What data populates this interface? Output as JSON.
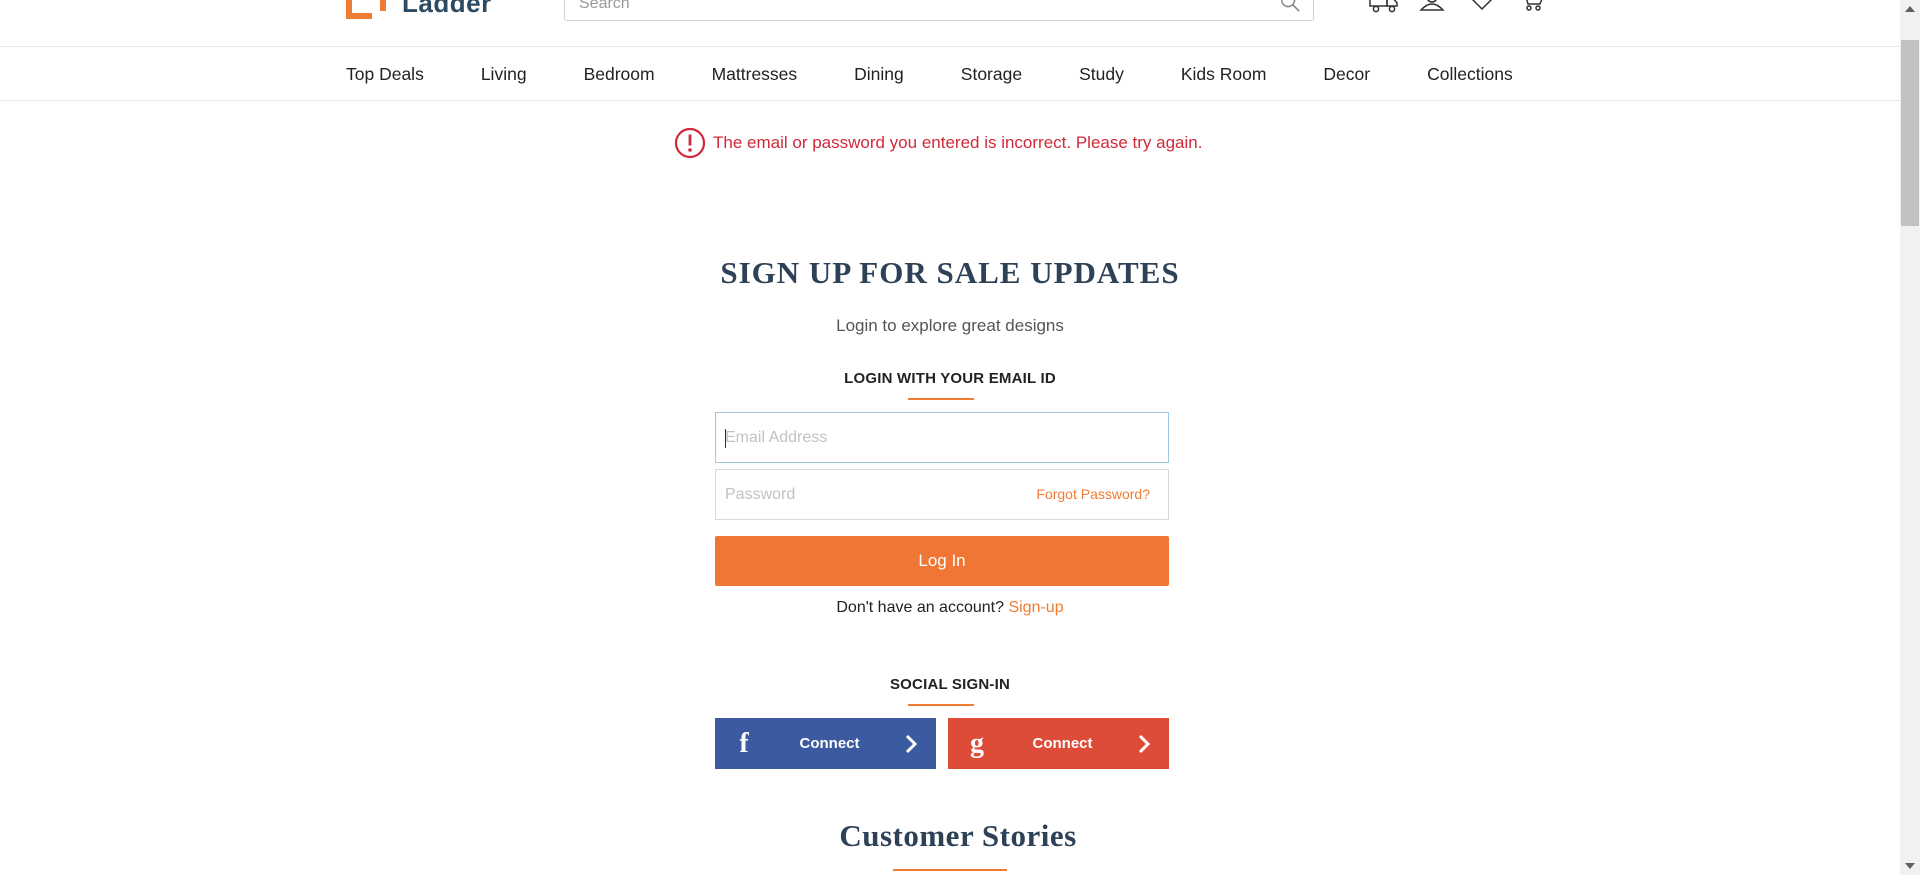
{
  "brand": {
    "name": "Ladder",
    "accent": "#f07c33",
    "text_color": "#2d4a63"
  },
  "search": {
    "placeholder": "Search"
  },
  "header_icons": [
    "delivery-truck-icon",
    "user-profile-icon",
    "wishlist-heart-icon",
    "cart-icon"
  ],
  "nav": {
    "items": [
      "Top Deals",
      "Living",
      "Bedroom",
      "Mattresses",
      "Dining",
      "Storage",
      "Study",
      "Kids Room",
      "Decor",
      "Collections"
    ]
  },
  "alert": {
    "message": "The email or password you entered is incorrect. Please try again.",
    "color": "#d0293a"
  },
  "login": {
    "title": "SIGN UP FOR SALE UPDATES",
    "subtitle": "Login to explore great designs",
    "section_heading": "LOGIN WITH YOUR EMAIL ID",
    "email_placeholder": "Email Address",
    "password_placeholder": "Password",
    "forgot_label": "Forgot Password?",
    "login_button": "Log In",
    "no_account_text": "Don't have an account?",
    "signup_link": "Sign-up"
  },
  "social": {
    "heading": "SOCIAL SIGN-IN",
    "facebook": {
      "label": "Connect",
      "color": "#3b5a9f"
    },
    "google": {
      "label": "Connect",
      "color": "#dd4b39"
    }
  },
  "stories": {
    "title": "Customer Stories"
  }
}
